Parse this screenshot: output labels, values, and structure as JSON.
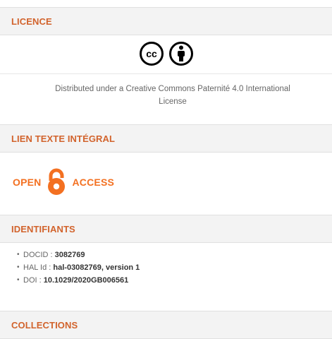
{
  "licence": {
    "title": "LICENCE",
    "text_line1": "Distributed under a Creative Commons Paternité 4.0 International",
    "text_line2": "License"
  },
  "fulltext": {
    "title": "LIEN TEXTE INTÉGRAL",
    "oa_left": "OPEN",
    "oa_right": "ACCESS"
  },
  "identifiants": {
    "title": "IDENTIFIANTS",
    "items": [
      {
        "label": "DOCID : ",
        "value": "3082769"
      },
      {
        "label": "HAL Id : ",
        "value": "hal-03082769, version 1"
      },
      {
        "label": "DOI : ",
        "value": "10.1029/2020GB006561"
      }
    ]
  },
  "collections": {
    "title": "COLLECTIONS"
  },
  "colors": {
    "accent": "#d2632c",
    "oa_orange": "#f37021"
  },
  "icons": [
    "cc-icon",
    "by-attribution-icon",
    "open-access-lock-icon"
  ]
}
